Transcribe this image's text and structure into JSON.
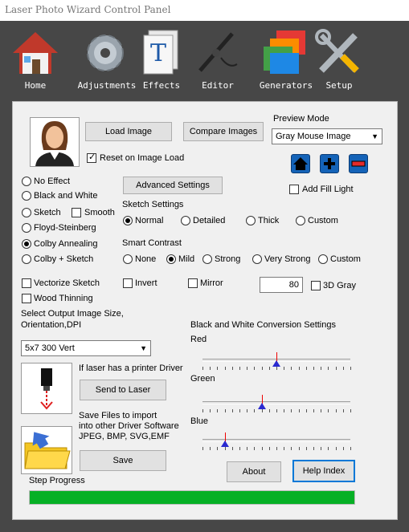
{
  "window": {
    "title": "Laser Photo Wizard Control Panel"
  },
  "toolbar": {
    "home": "Home",
    "adjustments": "Adjustments",
    "effects": "Effects",
    "editor": "Editor",
    "generators": "Generators",
    "setup": "Setup"
  },
  "top": {
    "load_image": "Load Image",
    "compare_images": "Compare Images",
    "reset_on_load": "Reset on Image Load",
    "preview_mode_label": "Preview Mode",
    "preview_mode_value": "Gray Mouse Image",
    "add_fill_light": "Add Fill Light"
  },
  "effects": {
    "no_effect": "No Effect",
    "black_white": "Black and White",
    "sketch": "Sketch",
    "smooth": "Smooth",
    "floyd": "Floyd-Steinberg",
    "colby": "Colby Annealing",
    "colby_sketch": "Colby + Sketch"
  },
  "advanced_settings": "Advanced Settings",
  "sketch_settings": {
    "label": "Sketch Settings",
    "normal": "Normal",
    "detailed": "Detailed",
    "thick": "Thick",
    "custom": "Custom"
  },
  "smart_contrast": {
    "label": "Smart Contrast",
    "none": "None",
    "mild": "Mild",
    "strong": "Strong",
    "very_strong": "Very Strong",
    "custom": "Custom"
  },
  "options": {
    "vectorize": "Vectorize Sketch",
    "invert": "Invert",
    "mirror": "Mirror",
    "gray_value": "80",
    "gray3d": "3D Gray",
    "wood_thinning": "Wood Thinning"
  },
  "output": {
    "label_line1": "Select Output Image Size,",
    "label_line2": "Orientation,DPI",
    "size_value": "5x7 300 Vert"
  },
  "bw_conversion": {
    "label": "Black and White Conversion Settings",
    "red": "Red",
    "green": "Green",
    "blue": "Blue",
    "red_value": 0.5,
    "green_value": 0.4,
    "blue_value": 0.15
  },
  "laser": {
    "printer_driver": "If laser has a printer Driver",
    "send_to_laser": "Send to Laser",
    "save_files_1": "Save Files to import",
    "save_files_2": " into other Driver Software",
    "save_files_3": "JPEG, BMP, SVG,EMF",
    "save": "Save"
  },
  "about": "About",
  "help_index": "Help Index",
  "step_progress": {
    "label": "Step Progress",
    "value": 1.0
  },
  "colors": {
    "progress": "#06b025",
    "accent": "#0078d7"
  }
}
